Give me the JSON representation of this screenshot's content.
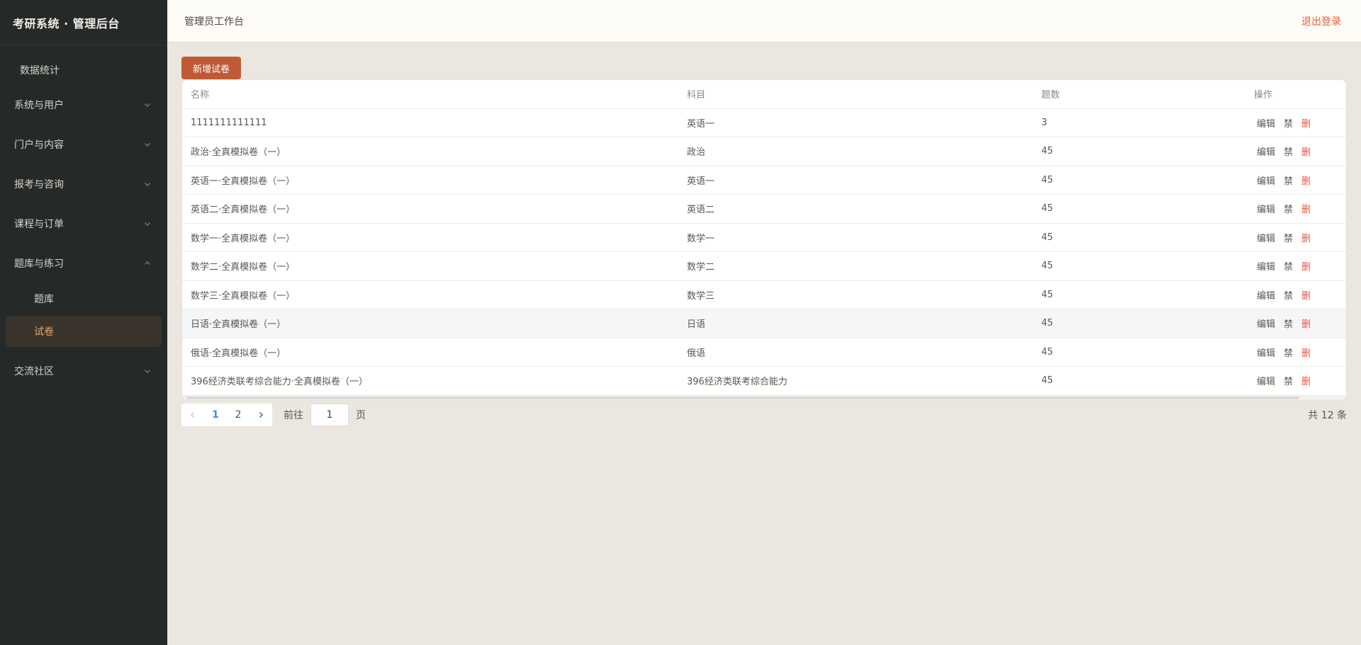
{
  "sidebar": {
    "brand": "考研系统 · 管理后台",
    "top_item": "数据统计",
    "groups": [
      {
        "label": "系统与用户",
        "expanded": false
      },
      {
        "label": "门户与内容",
        "expanded": false
      },
      {
        "label": "报考与咨询",
        "expanded": false
      },
      {
        "label": "课程与订单",
        "expanded": false
      },
      {
        "label": "题库与练习",
        "expanded": true,
        "children": [
          "题库",
          "试卷"
        ],
        "active_child": "试卷"
      },
      {
        "label": "交流社区",
        "expanded": false
      }
    ]
  },
  "header": {
    "title": "管理员工作台",
    "logout": "退出登录"
  },
  "toolbar": {
    "add_label": "新增试卷"
  },
  "table": {
    "columns": [
      "名称",
      "科目",
      "题数",
      "操作"
    ],
    "rows": [
      {
        "name": "1111111111111",
        "subject": "英语一",
        "count": "3"
      },
      {
        "name": "政治·全真模拟卷（一）",
        "subject": "政治",
        "count": "45"
      },
      {
        "name": "英语一·全真模拟卷（一）",
        "subject": "英语一",
        "count": "45"
      },
      {
        "name": "英语二·全真模拟卷（一）",
        "subject": "英语二",
        "count": "45"
      },
      {
        "name": "数学一·全真模拟卷（一）",
        "subject": "数学一",
        "count": "45"
      },
      {
        "name": "数学二·全真模拟卷（一）",
        "subject": "数学二",
        "count": "45"
      },
      {
        "name": "数学三·全真模拟卷（一）",
        "subject": "数学三",
        "count": "45"
      },
      {
        "name": "日语·全真模拟卷（一）",
        "subject": "日语",
        "count": "45"
      },
      {
        "name": "俄语·全真模拟卷（一）",
        "subject": "俄语",
        "count": "45"
      },
      {
        "name": "396经济类联考综合能力·全真模拟卷（一）",
        "subject": "396经济类联考综合能力",
        "count": "45"
      }
    ],
    "actions": {
      "edit": "编辑",
      "disable": "禁",
      "delete": "删"
    }
  },
  "pagination": {
    "pages": [
      "1",
      "2"
    ],
    "current": "1",
    "goto_prefix": "前往",
    "goto_value": "1",
    "goto_suffix": "页",
    "total": "共 12 条"
  },
  "colors": {
    "accent": "#c05a36",
    "active_menu_text": "#e3a66e",
    "danger": "#e6574a",
    "logout": "#e1603d",
    "pager_current": "#3b8ef0"
  }
}
